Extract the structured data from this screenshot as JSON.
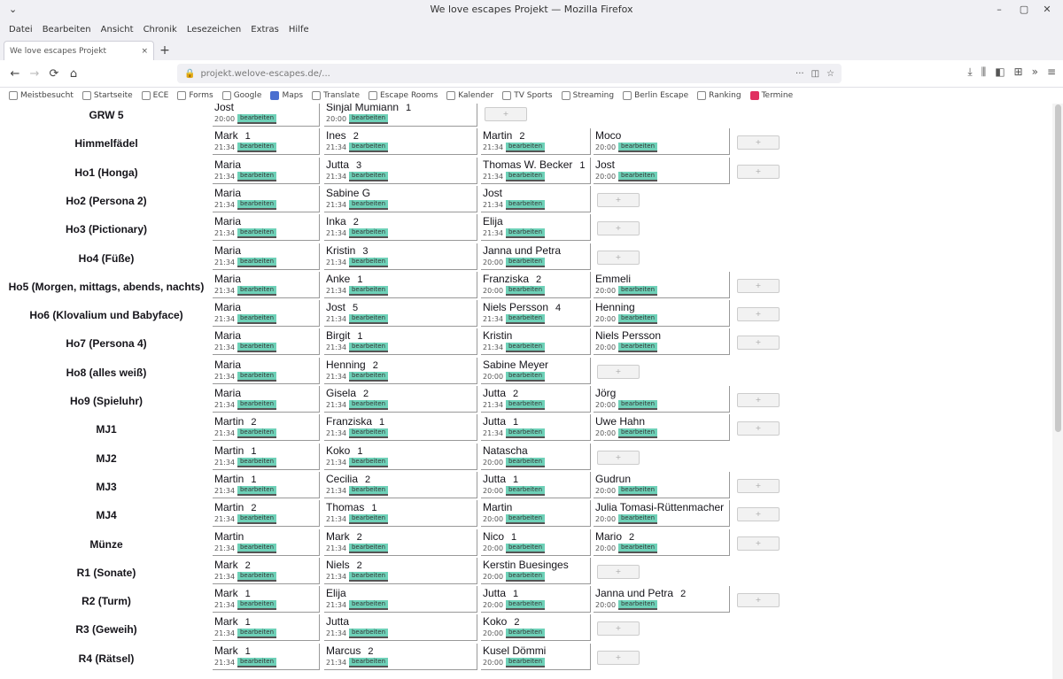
{
  "window": {
    "title": "We love escapes Projekt — Mozilla Firefox"
  },
  "menubar": [
    "Datei",
    "Bearbeiten",
    "Ansicht",
    "Chronik",
    "Lesezeichen",
    "Extras",
    "Hilfe"
  ],
  "tab": {
    "title": "We love escapes Projekt",
    "close": "×"
  },
  "toolbar": {
    "url": "projekt.welove-escapes.de/..."
  },
  "bookmarks": [
    "Meistbesucht",
    "Startseite",
    "ECE",
    "Forms",
    "Google",
    "Maps",
    "Translate",
    "Escape Rooms",
    "Kalender",
    "TV Sports",
    "Streaming",
    "Berlin Escape",
    "Ranking",
    "Termine"
  ],
  "rows": [
    {
      "name": "GRW 5",
      "cells": [
        {
          "n": "Jost",
          "t": "20:00",
          "b": "bearbeiten"
        },
        {
          "n": "Sinjal Mumiann",
          "num": "1",
          "t": "20:00",
          "b": "bearbeiten"
        },
        null,
        null
      ],
      "obtn_col": 3
    },
    {
      "name": "Himmelfädel",
      "cells": [
        {
          "n": "Mark",
          "num": "1",
          "t": "21:34",
          "b": "bearbeiten"
        },
        {
          "n": "Ines",
          "num": "2",
          "t": "21:34",
          "b": "bearbeiten"
        },
        {
          "n": "Martin",
          "num": "2",
          "t": "21:34",
          "b": "bearbeiten"
        },
        {
          "n": "Moco",
          "t": "20:00",
          "b": "bearbeiten"
        }
      ],
      "obtn_col": 5
    },
    {
      "name": "Ho1 (Honga)",
      "cells": [
        {
          "n": "Maria",
          "t": "21:34",
          "b": "bearbeiten"
        },
        {
          "n": "Jutta",
          "num": "3",
          "t": "21:34",
          "b": "bearbeiten"
        },
        {
          "n": "Thomas W. Becker",
          "num": "1",
          "t": "21:34",
          "b": "bearbeiten"
        },
        {
          "n": "Jost",
          "t": "20:00",
          "b": "bearbeiten"
        }
      ],
      "obtn_col": 5
    },
    {
      "name": "Ho2 (Persona 2)",
      "cells": [
        {
          "n": "Maria",
          "t": "21:34",
          "b": "bearbeiten"
        },
        {
          "n": "Sabine G",
          "t": "21:34",
          "b": "bearbeiten"
        },
        {
          "n": "Jost",
          "t": "21:34",
          "b": "bearbeiten"
        },
        null
      ],
      "obtn_col": 4
    },
    {
      "name": "Ho3 (Pictionary)",
      "cells": [
        {
          "n": "Maria",
          "t": "21:34",
          "b": "bearbeiten"
        },
        {
          "n": "Inka",
          "num": "2",
          "t": "21:34",
          "b": "bearbeiten"
        },
        {
          "n": "Elija",
          "t": "21:34",
          "b": "bearbeiten"
        },
        null
      ],
      "obtn_col": 4
    },
    {
      "name": "Ho4 (Füße)",
      "cells": [
        {
          "n": "Maria",
          "t": "21:34",
          "b": "bearbeiten"
        },
        {
          "n": "Kristin",
          "num": "3",
          "t": "21:34",
          "b": "bearbeiten"
        },
        {
          "n": "Janna und Petra",
          "t": "20:00",
          "b": "bearbeiten"
        },
        null
      ],
      "obtn_col": 4
    },
    {
      "name": "Ho5 (Morgen, mittags, abends, nachts)",
      "cells": [
        {
          "n": "Maria",
          "t": "21:34",
          "b": "bearbeiten"
        },
        {
          "n": "Anke",
          "num": "1",
          "t": "21:34",
          "b": "bearbeiten"
        },
        {
          "n": "Franziska",
          "num": "2",
          "t": "20:00",
          "b": "bearbeiten"
        },
        {
          "n": "Emmeli",
          "t": "20:00",
          "b": "bearbeiten"
        }
      ],
      "obtn_col": 5
    },
    {
      "name": "Ho6 (Klovalium und Babyface)",
      "cells": [
        {
          "n": "Maria",
          "t": "21:34",
          "b": "bearbeiten"
        },
        {
          "n": "Jost",
          "num": "5",
          "t": "21:34",
          "b": "bearbeiten"
        },
        {
          "n": "Niels Persson",
          "num": "4",
          "t": "21:34",
          "b": "bearbeiten"
        },
        {
          "n": "Henning",
          "t": "20:00",
          "b": "bearbeiten"
        }
      ],
      "obtn_col": 5
    },
    {
      "name": "Ho7 (Persona 4)",
      "cells": [
        {
          "n": "Maria",
          "t": "21:34",
          "b": "bearbeiten"
        },
        {
          "n": "Birgit",
          "num": "1",
          "t": "21:34",
          "b": "bearbeiten"
        },
        {
          "n": "Kristin",
          "t": "21:34",
          "b": "bearbeiten"
        },
        {
          "n": "Niels Persson",
          "t": "20:00",
          "b": "bearbeiten"
        }
      ],
      "obtn_col": 5
    },
    {
      "name": "Ho8 (alles weiß)",
      "cells": [
        {
          "n": "Maria",
          "t": "21:34",
          "b": "bearbeiten"
        },
        {
          "n": "Henning",
          "num": "2",
          "t": "21:34",
          "b": "bearbeiten"
        },
        {
          "n": "Sabine Meyer",
          "t": "20:00",
          "b": "bearbeiten"
        },
        null
      ],
      "obtn_col": 4
    },
    {
      "name": "Ho9 (Spieluhr)",
      "cells": [
        {
          "n": "Maria",
          "t": "21:34",
          "b": "bearbeiten"
        },
        {
          "n": "Gisela",
          "num": "2",
          "t": "21:34",
          "b": "bearbeiten"
        },
        {
          "n": "Jutta",
          "num": "2",
          "t": "21:34",
          "b": "bearbeiten"
        },
        {
          "n": "Jörg",
          "t": "20:00",
          "b": "bearbeiten"
        }
      ],
      "obtn_col": 5
    },
    {
      "name": "MJ1",
      "cells": [
        {
          "n": "Martin",
          "num": "2",
          "t": "21:34",
          "b": "bearbeiten"
        },
        {
          "n": "Franziska",
          "num": "1",
          "t": "21:34",
          "b": "bearbeiten"
        },
        {
          "n": "Jutta",
          "num": "1",
          "t": "21:34",
          "b": "bearbeiten"
        },
        {
          "n": "Uwe Hahn",
          "t": "20:00",
          "b": "bearbeiten"
        }
      ],
      "obtn_col": 5
    },
    {
      "name": "MJ2",
      "cells": [
        {
          "n": "Martin",
          "num": "1",
          "t": "21:34",
          "b": "bearbeiten"
        },
        {
          "n": "Koko",
          "num": "1",
          "t": "21:34",
          "b": "bearbeiten"
        },
        {
          "n": "Natascha",
          "t": "20:00",
          "b": "bearbeiten"
        },
        null
      ],
      "obtn_col": 4
    },
    {
      "name": "MJ3",
      "cells": [
        {
          "n": "Martin",
          "num": "1",
          "t": "21:34",
          "b": "bearbeiten"
        },
        {
          "n": "Cecilia",
          "num": "2",
          "t": "21:34",
          "b": "bearbeiten"
        },
        {
          "n": "Jutta",
          "num": "1",
          "t": "20:00",
          "b": "bearbeiten"
        },
        {
          "n": "Gudrun",
          "t": "20:00",
          "b": "bearbeiten"
        }
      ],
      "obtn_col": 5
    },
    {
      "name": "MJ4",
      "cells": [
        {
          "n": "Martin",
          "num": "2",
          "t": "21:34",
          "b": "bearbeiten"
        },
        {
          "n": "Thomas",
          "num": "1",
          "t": "21:34",
          "b": "bearbeiten"
        },
        {
          "n": "Martin",
          "t": "20:00",
          "b": "bearbeiten"
        },
        {
          "n": "Julia Tomasi-Rüttenmacher",
          "t": "20:00",
          "b": "bearbeiten"
        }
      ],
      "obtn_col": 5
    },
    {
      "name": "Münze",
      "cells": [
        {
          "n": "Martin",
          "t": "21:34",
          "b": "bearbeiten"
        },
        {
          "n": "Mark",
          "num": "2",
          "t": "21:34",
          "b": "bearbeiten"
        },
        {
          "n": "Nico",
          "num": "1",
          "t": "20:00",
          "b": "bearbeiten"
        },
        {
          "n": "Mario",
          "num": "2",
          "t": "20:00",
          "b": "bearbeiten"
        }
      ],
      "obtn_col": 5
    },
    {
      "name": "R1 (Sonate)",
      "cells": [
        {
          "n": "Mark",
          "num": "2",
          "t": "21:34",
          "b": "bearbeiten"
        },
        {
          "n": "Niels",
          "num": "2",
          "t": "21:34",
          "b": "bearbeiten"
        },
        {
          "n": "Kerstin Buesinges",
          "t": "20:00",
          "b": "bearbeiten"
        },
        null
      ],
      "obtn_col": 4
    },
    {
      "name": "R2 (Turm)",
      "cells": [
        {
          "n": "Mark",
          "num": "1",
          "t": "21:34",
          "b": "bearbeiten"
        },
        {
          "n": "Elija",
          "t": "21:34",
          "b": "bearbeiten"
        },
        {
          "n": "Jutta",
          "num": "1",
          "t": "20:00",
          "b": "bearbeiten"
        },
        {
          "n": "Janna und Petra",
          "num": "2",
          "t": "20:00",
          "b": "bearbeiten"
        }
      ],
      "obtn_col": 5
    },
    {
      "name": "R3 (Geweih)",
      "cells": [
        {
          "n": "Mark",
          "num": "1",
          "t": "21:34",
          "b": "bearbeiten"
        },
        {
          "n": "Jutta",
          "t": "21:34",
          "b": "bearbeiten"
        },
        {
          "n": "Koko",
          "num": "2",
          "t": "20:00",
          "b": "bearbeiten"
        },
        null
      ],
      "obtn_col": 4
    },
    {
      "name": "R4 (Rätsel)",
      "cells": [
        {
          "n": "Mark",
          "num": "1",
          "t": "21:34",
          "b": "bearbeiten"
        },
        {
          "n": "Marcus",
          "num": "2",
          "t": "21:34",
          "b": "bearbeiten"
        },
        {
          "n": "Kusel Dömmi",
          "t": "20:00",
          "b": "bearbeiten"
        },
        null
      ],
      "obtn_col": 4
    }
  ],
  "other_button": "+"
}
